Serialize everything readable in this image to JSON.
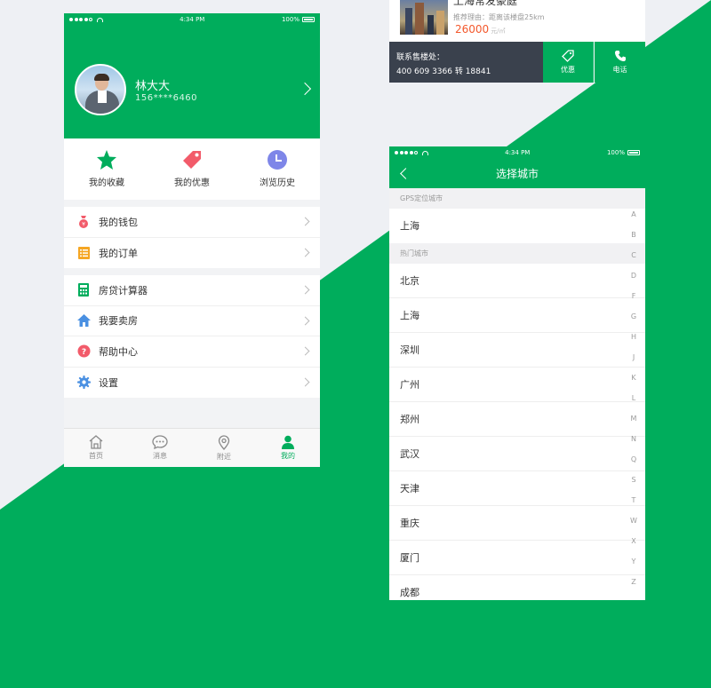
{
  "colors": {
    "brand_green": "#00ad5c",
    "background": "#eef0f4",
    "price_red": "#f3582c",
    "dark_bar": "#3a414d"
  },
  "profile_screen": {
    "status": {
      "time": "4:34 PM",
      "battery": "100%"
    },
    "user": {
      "name": "林大大",
      "phone": "156****6460",
      "avatar_icon": "user-avatar"
    },
    "quick_actions": [
      {
        "label": "我的收藏",
        "icon": "star-icon",
        "color": "#00ad5c"
      },
      {
        "label": "我的优惠",
        "icon": "tag-icon",
        "color": "#f25b6a"
      },
      {
        "label": "浏览历史",
        "icon": "clock-icon",
        "color": "#7e86e8"
      }
    ],
    "menu_groups": [
      [
        {
          "label": "我的钱包",
          "icon": "money-bag-icon",
          "color": "#f25b6a"
        },
        {
          "label": "我的订单",
          "icon": "list-icon",
          "color": "#f5a623"
        }
      ],
      [
        {
          "label": "房贷计算器",
          "icon": "calculator-icon",
          "color": "#00ad5c"
        },
        {
          "label": "我要卖房",
          "icon": "house-icon",
          "color": "#4a90e2"
        },
        {
          "label": "帮助中心",
          "icon": "help-icon",
          "color": "#f25b6a"
        },
        {
          "label": "设置",
          "icon": "gear-icon",
          "color": "#4a90e2"
        }
      ]
    ],
    "tabs": [
      {
        "label": "首页",
        "icon": "home-icon",
        "active": false
      },
      {
        "label": "消息",
        "icon": "message-icon",
        "active": false
      },
      {
        "label": "附近",
        "icon": "location-icon",
        "active": false
      },
      {
        "label": "我的",
        "icon": "person-icon",
        "active": true
      }
    ]
  },
  "listing_card": {
    "title": "上海常发豪庭",
    "reason": "推荐理由：距离该楼盘25km",
    "price": "26000",
    "price_unit": "元/㎡",
    "contact_label": "联系售楼处：",
    "contact_number": "400 609 3366 转 18841",
    "discount_label": "优惠",
    "call_label": "电话"
  },
  "city_screen": {
    "status": {
      "time": "4:34 PM",
      "battery": "100%"
    },
    "title": "选择城市",
    "gps_header": "GPS定位城市",
    "gps_city": "上海",
    "hot_header": "热门城市",
    "hot_cities": [
      "北京",
      "上海",
      "深圳",
      "广州",
      "郑州",
      "武汉",
      "天津",
      "重庆",
      "厦门",
      "成都"
    ],
    "alphabet": [
      "A",
      "B",
      "C",
      "D",
      "F",
      "G",
      "H",
      "J",
      "K",
      "L",
      "M",
      "N",
      "Q",
      "S",
      "T",
      "W",
      "X",
      "Y",
      "Z"
    ]
  }
}
